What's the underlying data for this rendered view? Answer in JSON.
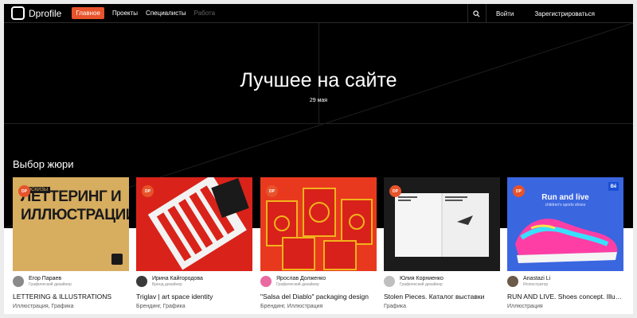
{
  "nav": {
    "logo": "Dprofile",
    "items": [
      {
        "label": "Главное",
        "active": true
      },
      {
        "label": "Проекты"
      },
      {
        "label": "Специалисты"
      },
      {
        "label": "Работа",
        "muted": true
      }
    ],
    "search_icon": "search-icon",
    "login": "Войти",
    "register": "Зарегистрироваться"
  },
  "hero": {
    "title": "Лучшее на сайте",
    "date": "29 мая"
  },
  "section": {
    "title": "Выбор жюри"
  },
  "badge": "DP",
  "cards": [
    {
      "thumb_text": "ЛЕТТЕРИНГ И ИЛЛЮСТРАЦИИ",
      "thumb_sub": "• ЭСКИЗЫ",
      "author": "Егор Параев",
      "role": "Графический дизайнер",
      "title": "LETTERING & ILLUSTRATIONS",
      "tags": "Иллюстрация, Графика"
    },
    {
      "author": "Ирина Кайгородова",
      "role": "Бренд дизайнер",
      "title": "Triglav | art space identity",
      "tags": "Брендинг, Графика"
    },
    {
      "author": "Ярослав Долженко",
      "role": "Графический дизайнер",
      "title": "\"Salsa del Diablo\" packaging design",
      "tags": "Брендинг, Иллюстрация"
    },
    {
      "author": "Юлия Корниенко",
      "role": "Графический дизайнер",
      "title": "Stolen Pieces. Каталог выставки",
      "tags": "Графика"
    },
    {
      "thumb_text": "Run and live",
      "thumb_sub": "children's sports shoes",
      "thumb_badge": "Bē",
      "author": "Anastazi Li",
      "role": "Иллюстратор",
      "title": "RUN AND LIVE. Shoes concept. Illustration",
      "tags": "Иллюстрация"
    }
  ],
  "colors": {
    "accent": "#e8532b",
    "background": "#000000"
  }
}
